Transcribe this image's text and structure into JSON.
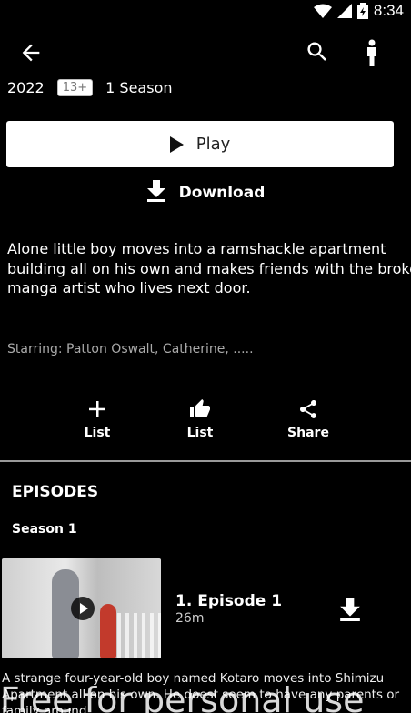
{
  "status_bar": {
    "time": "8:34"
  },
  "meta": {
    "year": "2022",
    "rating": "13+",
    "seasons": "1 Season"
  },
  "buttons": {
    "play": "Play",
    "download": "Download"
  },
  "synopsis": {
    "line1": "Alone little boy moves into a ramshackle apartment",
    "line2": "building all on his own and makes friends with the broke",
    "line3": "manga artist who lives next door."
  },
  "starring": "Starring: Patton Oswalt, Catherine, .....",
  "actions": {
    "add_list": "List",
    "rate_list": "List",
    "share": "Share"
  },
  "episodes": {
    "title": "EPISODES",
    "season": "Season 1",
    "items": [
      {
        "title": "1. Episode 1",
        "duration": "26m",
        "desc_line1": "A strange four-year-old boy named Kotaro moves into Shimizu",
        "desc_line2": "Apartment all on his own. He doest seem to have any parents or",
        "desc_line3": "family around."
      }
    ]
  },
  "watermark": "Free for personal use",
  "colors": {
    "background": "#000000",
    "play_button_bg": "#ffffff",
    "divider": "#999999"
  }
}
